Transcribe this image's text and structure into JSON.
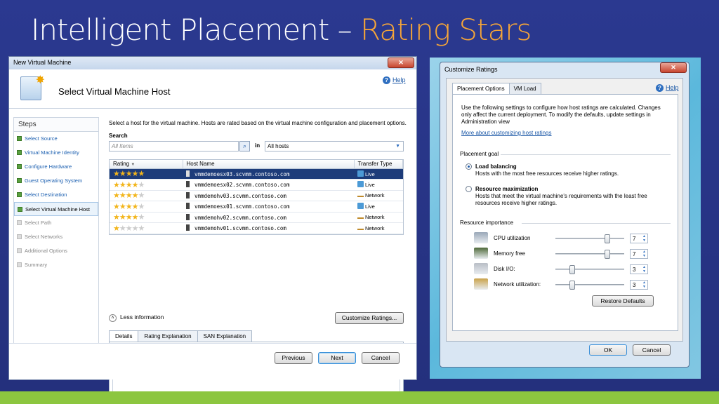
{
  "slide": {
    "title_main": "Intelligent Placement – ",
    "title_accent": "Rating Stars"
  },
  "wizard": {
    "window_title": "New Virtual Machine",
    "header_title": "Select Virtual Machine Host",
    "help": "Help",
    "steps_header": "Steps",
    "steps": [
      {
        "label": "Select Source",
        "state": "done"
      },
      {
        "label": "Virtual Machine Identity",
        "state": "done"
      },
      {
        "label": "Configure Hardware",
        "state": "done"
      },
      {
        "label": "Guest Operating System",
        "state": "done"
      },
      {
        "label": "Select Destination",
        "state": "done"
      },
      {
        "label": "Select Virtual Machine Host",
        "state": "active"
      },
      {
        "label": "Select Path",
        "state": "pending"
      },
      {
        "label": "Select Networks",
        "state": "pending"
      },
      {
        "label": "Additional Options",
        "state": "pending"
      },
      {
        "label": "Summary",
        "state": "pending"
      }
    ],
    "intro": "Select a host for the virtual machine. Hosts are rated based on the virtual machine configuration and placement options.",
    "search_label": "Search",
    "search_placeholder": "All Items",
    "in_label": "in",
    "in_value": "All hosts",
    "columns": [
      "Rating",
      "Host Name",
      "Transfer Type"
    ],
    "hosts": [
      {
        "rating": 5,
        "name": "vmmdemoesx03.scvmm.contoso.com",
        "transfer": "Live"
      },
      {
        "rating": 4,
        "name": "vmmdemoesx02.scvmm.contoso.com",
        "transfer": "Live"
      },
      {
        "rating": 4,
        "name": "vmmdemohv03.scvmm.contoso.com",
        "transfer": "Network"
      },
      {
        "rating": 4,
        "name": "vmmdemoesx01.scvmm.contoso.com",
        "transfer": "Live"
      },
      {
        "rating": 4,
        "name": "vmmdemohv02.scvmm.contoso.com",
        "transfer": "Network"
      },
      {
        "rating": 1,
        "name": "vmmdemohv01.scvmm.contoso.com",
        "transfer": "Network"
      }
    ],
    "less_info": "Less information",
    "customize_button": "Customize Ratings...",
    "detail_tabs": [
      "Details",
      "Rating Explanation",
      "SAN Explanation"
    ],
    "previous": "Previous",
    "next": "Next",
    "cancel": "Cancel"
  },
  "ratings": {
    "window_title": "Customize Ratings",
    "tabs": [
      "Placement Options",
      "VM Load"
    ],
    "help": "Help",
    "description": "Use the following settings to configure how host ratings are calculated. Changes only affect the current deployment. To modify the defaults, update settings in Administration view",
    "link": "More about customizing host ratings",
    "placement_goal": "Placement goal",
    "goal_options": [
      {
        "title": "Load balancing",
        "desc": "Hosts with the most free resources receive higher ratings.",
        "selected": true
      },
      {
        "title": "Resource maximization",
        "desc": "Hosts that meet the virtual machine's requirements with the least free resources receive higher ratings.",
        "selected": false
      }
    ],
    "resource_importance": "Resource importance",
    "resources": [
      {
        "label": "CPU utilization",
        "value": "7",
        "level": 0.78,
        "icon": "cpu-icon"
      },
      {
        "label": "Memory free",
        "value": "7",
        "level": 0.78,
        "icon": "memory-icon"
      },
      {
        "label": "Disk I/O:",
        "value": "3",
        "level": 0.22,
        "icon": "disk-icon"
      },
      {
        "label": "Network utilization:",
        "value": "3",
        "level": 0.22,
        "icon": "network-icon"
      }
    ],
    "restore_defaults": "Restore Defaults",
    "ok": "OK",
    "cancel": "Cancel"
  }
}
